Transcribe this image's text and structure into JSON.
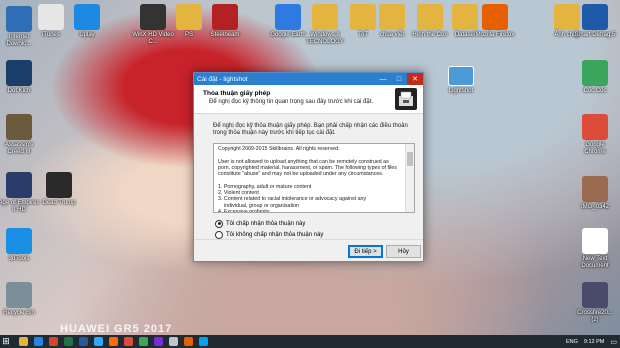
{
  "desktop_icons_left": [
    {
      "label": "Internet Downlo...",
      "color": "#2f6fb8"
    },
    {
      "label": "Dot Kich",
      "color": "#1b3d6a"
    },
    {
      "label": "Assassin's Creed III",
      "color": "#6b5a3b"
    },
    {
      "label": "Age of Empires II HD",
      "color": "#2c3c6a"
    },
    {
      "label": "3uTools",
      "color": "#1a8fe6"
    },
    {
      "label": "Recycle Bin",
      "color": "#7a8f9a"
    }
  ],
  "desktop_icons_row2": [
    {
      "label": "Dead Trump",
      "color": "#2a2a2a"
    }
  ],
  "desktop_icons_top": [
    {
      "label": "iTunes",
      "color": "#e6e6e6"
    },
    {
      "label": "Uplay",
      "color": "#1e88e5"
    },
    {
      "label": "WinX HD Video C...",
      "color": "#333333"
    },
    {
      "label": "PS",
      "color": "#e3b43f"
    },
    {
      "label": "Steelbeam",
      "color": "#b32222"
    },
    {
      "label": "Google Earth",
      "color": "#2d7be0"
    },
    {
      "label": "Windows 8 TECNOLOGY",
      "color": "#e3b43f"
    },
    {
      "label": "ToT",
      "color": "#e3b43f"
    },
    {
      "label": "chua viết",
      "color": "#e3b43f"
    },
    {
      "label": "Hình thẻ Con",
      "color": "#e3b43f"
    },
    {
      "label": "Datasel",
      "color": "#e3b43f"
    },
    {
      "label": "Mozilla Firefox",
      "color": "#e66000"
    },
    {
      "label": "Ảnh chụp",
      "color": "#e3b43f"
    }
  ],
  "desktop_icons_right": [
    {
      "label": "Smart Defrag 5",
      "color": "#1e5aa8"
    },
    {
      "label": "Cốc Cốc",
      "color": "#3aa55b"
    },
    {
      "label": "Google Chrome",
      "color": "#dd4b39"
    },
    {
      "label": "IMG_0342",
      "color": "#9b6b50"
    },
    {
      "label": "New Text Document",
      "color": "#ffffff"
    },
    {
      "label": "Crossfire20... (2)",
      "color": "#4a4a6a"
    }
  ],
  "lightshot_shortcut": {
    "label": "Lightshot"
  },
  "window": {
    "title": "Cài đặt - lightshot",
    "min": "—",
    "max": "□",
    "close": "✕",
    "header_title": "Thỏa thuận giấy phép",
    "header_subtitle": "Để nghị đọc kỹ thông tin quan trọng sau đây trước khi cài đặt.",
    "body_text": "Để nghị đọc kỹ thỏa thuận giấy phép. Bạn phải chấp nhận các điều thoản trong thỏa thuận này trước khi tiếp tục cài đặt.",
    "license_text": "Copyright 2009-2015 Skillbrains. All rights reserved.\n\nUser is not allowed to upload anything that can be remotely construed as porn, copyrighted material, harassment, or spam. The following types of files constitute \"abuse\" and may not be uploaded under any circumstances.\n\n1. Pornography, adult or mature content\n2. Violent content\n3. Content related to racial intolerance or advocacy against any\n    individual, group or organisation\n4. Excessive profanity",
    "radio_accept": "Tôi chấp nhận thỏa thuận này",
    "radio_decline": "Tôi không chấp nhận thỏa thuận này",
    "next_button": "Đi tiếp >",
    "cancel_button": "Hủy"
  },
  "watermark": "HUAWEI GR5 2017",
  "taskbar": {
    "start_icon": "windows-icon",
    "pinned": [
      "#e3b43f",
      "#1e88e5",
      "#d24726",
      "#217346",
      "#2b579a",
      "#31a8ff",
      "#ff6a00",
      "#dd4b39",
      "#3aa55b",
      "#7b2ad8",
      "#c4c4c4",
      "#e66000",
      "#00a4ef"
    ],
    "language": "ENG",
    "time": "9:12 PM"
  }
}
